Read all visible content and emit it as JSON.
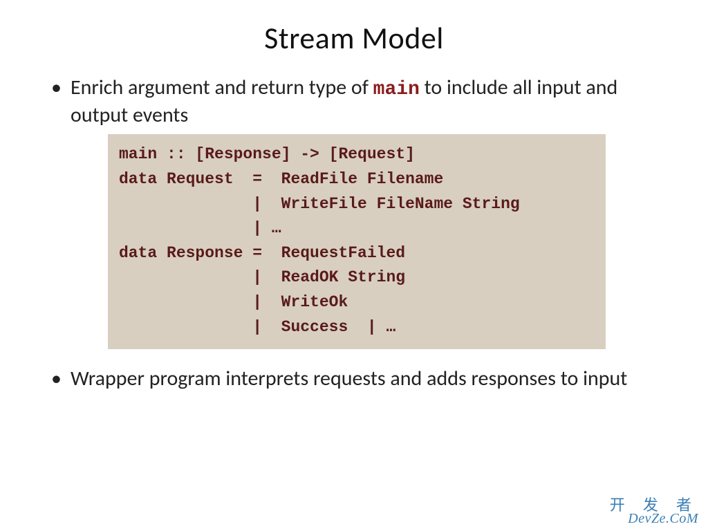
{
  "title": "Stream Model",
  "bullet1": {
    "pre": "Enrich argument and return type of ",
    "kw": "main",
    "post": " to include all input and output events"
  },
  "code": "main :: [Response] -> [Request]\ndata Request  =  ReadFile Filename\n              |  WriteFile FileName String\n              | …\ndata Response =  RequestFailed\n              |  ReadOK String\n              |  WriteOk\n              |  Success  | …",
  "bullet2": "Wrapper program interprets requests and adds responses to input",
  "watermark": {
    "cn": "开 发 者",
    "en": "DevZe.CoM"
  }
}
